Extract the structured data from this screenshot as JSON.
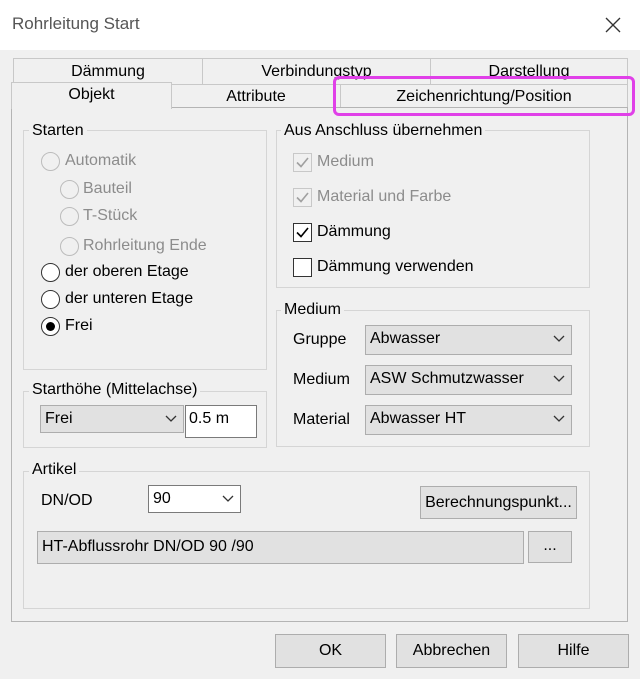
{
  "window": {
    "title": "Rohrleitung Start"
  },
  "tabs_back": [
    {
      "label": "Dämmung"
    },
    {
      "label": "Verbindungstyp"
    },
    {
      "label": "Darstellung"
    }
  ],
  "tabs_front": [
    {
      "label": "Objekt",
      "selected": true
    },
    {
      "label": "Attribute"
    },
    {
      "label": "Zeichenrichtung/Position"
    }
  ],
  "starten": {
    "legend": "Starten",
    "options": [
      {
        "label": "Automatik",
        "enabled": false,
        "checked": false
      },
      {
        "label": "Bauteil",
        "enabled": false,
        "checked": false
      },
      {
        "label": "T-Stück",
        "enabled": false,
        "checked": false
      },
      {
        "label": "Rohrleitung Ende",
        "enabled": false,
        "checked": false
      },
      {
        "label": "der oberen Etage",
        "enabled": true,
        "checked": false
      },
      {
        "label": "der unteren Etage",
        "enabled": true,
        "checked": false
      },
      {
        "label": "Frei",
        "enabled": true,
        "checked": true
      }
    ]
  },
  "starthoehe": {
    "legend": "Starthöhe (Mittelachse)",
    "mode": "Frei",
    "value": "0.5 m"
  },
  "anschluss": {
    "legend": "Aus Anschluss übernehmen",
    "items": [
      {
        "label": "Medium",
        "enabled": false,
        "checked": true
      },
      {
        "label": "Material und Farbe",
        "enabled": false,
        "checked": true
      },
      {
        "label": "Dämmung",
        "enabled": true,
        "checked": true
      },
      {
        "label": "Dämmung verwenden",
        "enabled": true,
        "checked": false
      }
    ]
  },
  "medium": {
    "legend": "Medium",
    "rows": [
      {
        "label": "Gruppe",
        "value": "Abwasser"
      },
      {
        "label": "Medium",
        "value": "ASW Schmutzwasser"
      },
      {
        "label": "Material",
        "value": "Abwasser HT"
      }
    ]
  },
  "artikel": {
    "legend": "Artikel",
    "dnod_label": "DN/OD",
    "dnod_value": "90",
    "calc_button": "Berechnungspunkt...",
    "description": "HT-Abflussrohr DN/OD 90 /90",
    "browse_button": "..."
  },
  "footer": {
    "ok": "OK",
    "cancel": "Abbrechen",
    "help": "Hilfe"
  },
  "colors": {
    "highlight": "#e040e8",
    "background": "#f0f0f0"
  }
}
